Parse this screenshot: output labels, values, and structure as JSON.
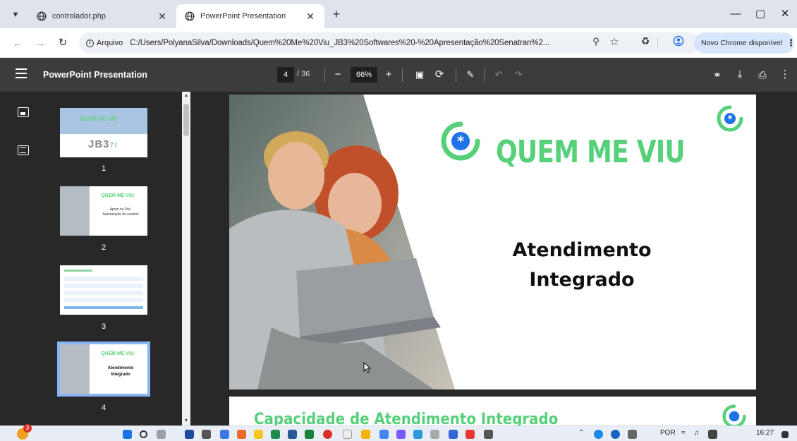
{
  "browser": {
    "tabs": [
      {
        "title": "controlador.php",
        "active": false
      },
      {
        "title": "PowerPoint Presentation",
        "active": true
      }
    ],
    "new_tab_symbol": "+",
    "window_controls": {
      "minimize": "—",
      "maximize": "▢",
      "close": "✕"
    },
    "site_info_label": "Arquivo",
    "url": "C:/Users/PolyanaSilva/Downloads/Quem%20Me%20Viu_JB3%20Softwares%20-%20Apresentação%20Senatran%2...",
    "update_button": "Novo Chrome disponível",
    "accent_color": "#8ab4f8"
  },
  "pdf_viewer": {
    "title": "PowerPoint Presentation",
    "current_page": "4",
    "page_total": "/ 36",
    "zoom": "66%",
    "thumbnails": [
      {
        "number": "1",
        "logo": "QUEM ME VIU",
        "brand": "JB3",
        "brand_suffix": "TI"
      },
      {
        "number": "2",
        "logo": "QUEM ME VIU",
        "caption": "Apoio na Pré-Autorização do usuário"
      },
      {
        "number": "3"
      },
      {
        "number": "4",
        "logo": "QUEM ME VIU",
        "caption": "Atendimento Integrado",
        "selected": true
      }
    ]
  },
  "slide": {
    "logo_text": "QUEM ME VIU",
    "heading_line1": "Atendimento",
    "heading_line2": "Integrado",
    "brand_color": "#57d07a",
    "next_slide_title": "Capacidade de Atendimento Integrado"
  },
  "taskbar": {
    "notification_count": "3",
    "language": "POR",
    "time": "16:27"
  }
}
